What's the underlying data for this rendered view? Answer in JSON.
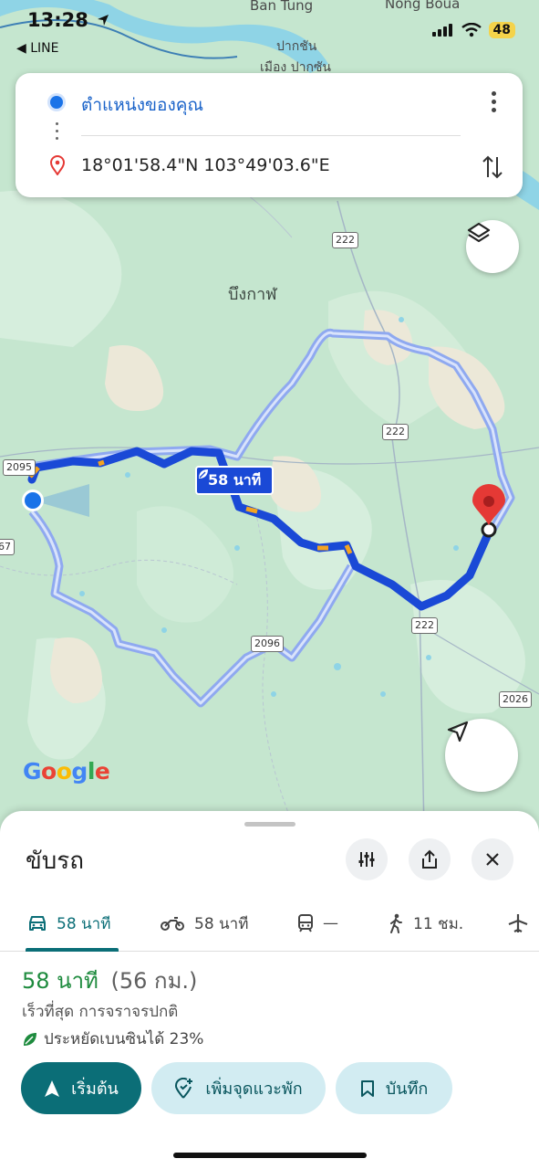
{
  "status_bar": {
    "time": "13:28",
    "back_app": "◀ LINE",
    "battery": "48"
  },
  "map": {
    "places": [
      {
        "name": "Ban Tung"
      },
      {
        "name": "Nong Boua"
      },
      {
        "name": "ปากชัน"
      },
      {
        "name": "เมือง ปากซัน"
      },
      {
        "name": "บึงกาฬ"
      }
    ],
    "road_shields": [
      "2095",
      "222",
      "222",
      "2096",
      "222",
      "2026",
      "67"
    ],
    "route_badge": "58 นาที",
    "google_logo": "Google",
    "colors": {
      "route_primary": "#1a49d6",
      "route_alt": "#8fa9f0",
      "destination_pin": "#e53935",
      "land": "#c5e6cf"
    }
  },
  "directions": {
    "origin": "ตำแหน่งของคุณ",
    "destination": "18°01'58.4\"N 103°49'03.6\"E"
  },
  "sheet": {
    "title": "ขับรถ",
    "tabs": [
      {
        "icon": "car-icon",
        "label": "58 นาที",
        "active": true
      },
      {
        "icon": "motorcycle-icon",
        "label": "58 นาที",
        "active": false
      },
      {
        "icon": "transit-icon",
        "label": "—",
        "active": false
      },
      {
        "icon": "walk-icon",
        "label": "11 ชม.",
        "active": false
      },
      {
        "icon": "flight-icon",
        "label": "",
        "active": false
      }
    ],
    "summary": {
      "time": "58 นาที",
      "distance": "(56 กม.)",
      "subtitle": "เร็วที่สุด การจราจรปกติ",
      "eco": "ประหยัดเบนซินได้ 23%"
    },
    "buttons": {
      "start": "เริ่มต้น",
      "add_stop": "เพิ่มจุดแวะพัก",
      "save": "บันทึก"
    },
    "colors": {
      "accent": "#0b6e77",
      "eta_green": "#1e8b3e",
      "secondary_button_bg": "#d2ecf2"
    }
  }
}
